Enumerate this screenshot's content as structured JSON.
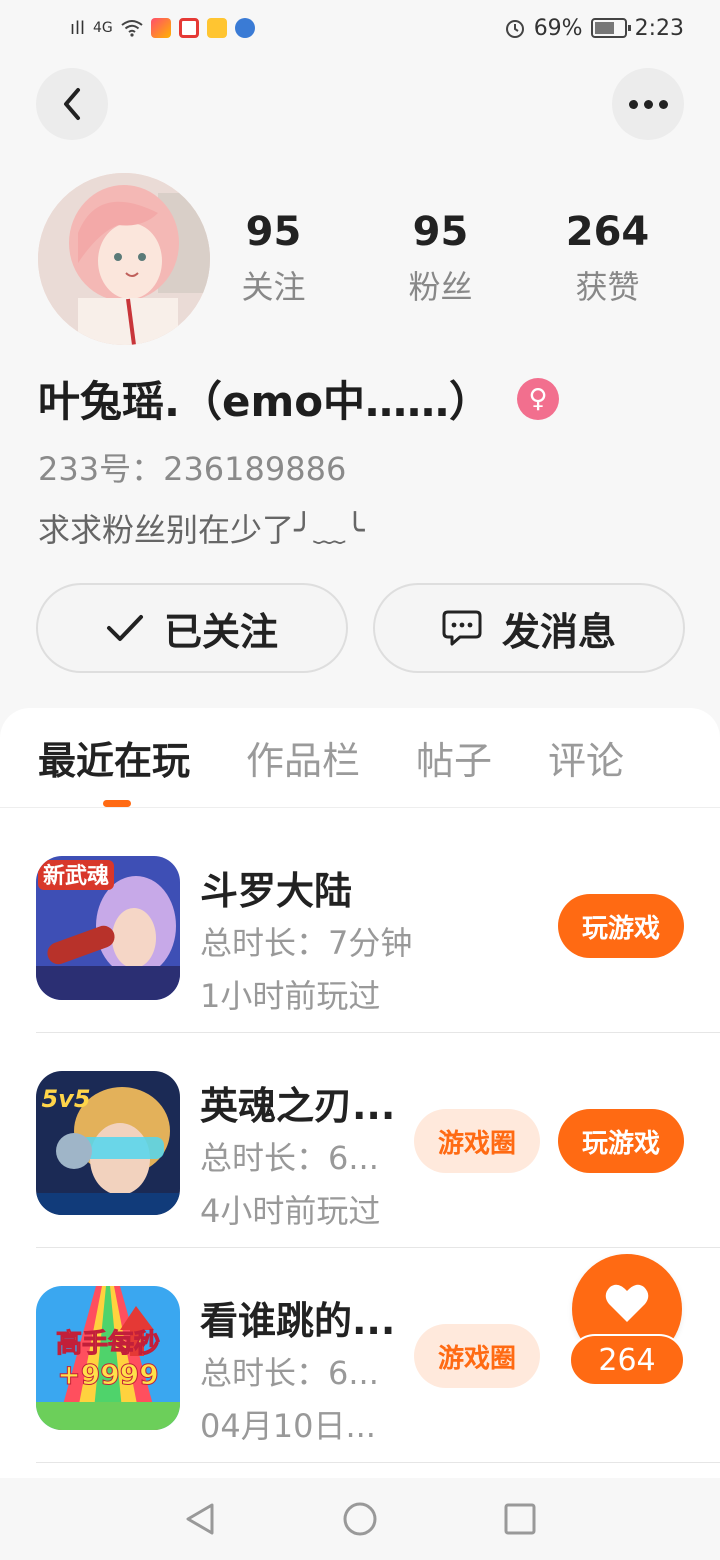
{
  "status_bar": {
    "signal1": "ıll",
    "network": "4G",
    "battery_percent": "69%",
    "battery_level": 0.69,
    "time": "2:23",
    "alarm_icon": "alarm-icon"
  },
  "profile": {
    "stats": [
      {
        "value": "95",
        "label": "关注"
      },
      {
        "value": "95",
        "label": "粉丝"
      },
      {
        "value": "264",
        "label": "获赞"
      }
    ],
    "name": "叶兔瑶.（emo中……）",
    "gender_icon": "female-icon",
    "uid": "233号：236189886",
    "bio": "求求粉丝别在少了╯﹏╰"
  },
  "actions": {
    "follow_label": "已关注",
    "message_label": "发消息"
  },
  "tabs": [
    "最近在玩",
    "作品栏",
    "帖子",
    "评论"
  ],
  "games": [
    {
      "title": "斗罗大陆",
      "duration": "总时长：7分钟",
      "last_played": "1小时前玩过",
      "play_label": "玩游戏",
      "circle_label": ""
    },
    {
      "title": "英魂之刃...",
      "duration": "总时长：6...",
      "last_played": "4小时前玩过",
      "play_label": "玩游戏",
      "circle_label": "游戏圈"
    },
    {
      "title": "看谁跳的...",
      "duration": "总时长：6...",
      "last_played": "04月10日...",
      "play_label": "",
      "circle_label": "游戏圈"
    }
  ],
  "game_icon_texts": {
    "g1": "新武魂",
    "g2": "5v5",
    "g3_line1": "高手每秒",
    "g3_line2": "+9999"
  },
  "like": {
    "count": "264"
  }
}
